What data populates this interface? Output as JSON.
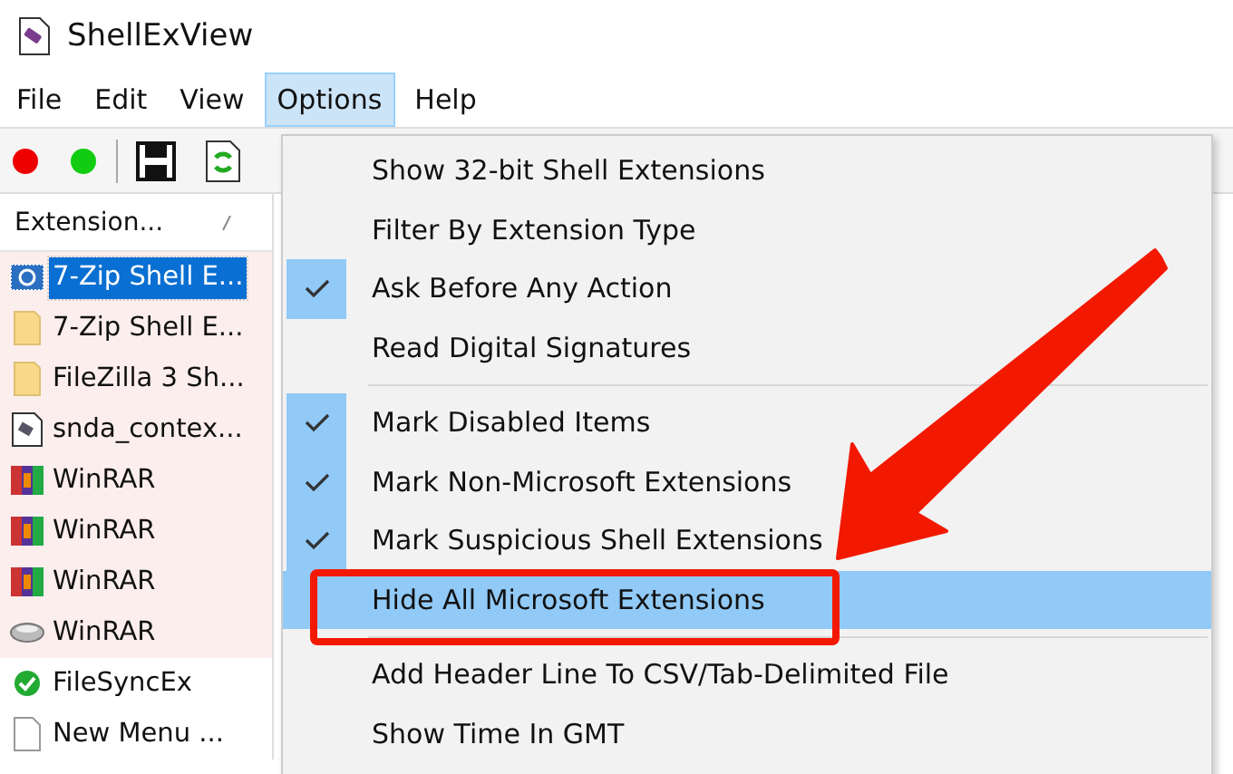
{
  "window": {
    "title": "ShellExView"
  },
  "menu_bar": [
    {
      "label": "File",
      "selected": false
    },
    {
      "label": "Edit",
      "selected": false
    },
    {
      "label": "View",
      "selected": false
    },
    {
      "label": "Options",
      "selected": true
    },
    {
      "label": "Help",
      "selected": false
    }
  ],
  "table": {
    "columns": [
      {
        "label": "Extension..."
      }
    ],
    "rows": [
      {
        "name": "7-Zip Shell E...",
        "kind": "component",
        "selected": true,
        "marked": true
      },
      {
        "name": "7-Zip Shell E...",
        "kind": "folder",
        "selected": false,
        "marked": true
      },
      {
        "name": "FileZilla 3 Sh...",
        "kind": "folder",
        "selected": false,
        "marked": true
      },
      {
        "name": "snda_contex...",
        "kind": "script",
        "selected": false,
        "marked": true
      },
      {
        "name": "WinRAR",
        "kind": "archive",
        "selected": false,
        "marked": true
      },
      {
        "name": "WinRAR",
        "kind": "archive",
        "selected": false,
        "marked": true
      },
      {
        "name": "WinRAR",
        "kind": "archive",
        "selected": false,
        "marked": true
      },
      {
        "name": "WinRAR",
        "kind": "drive",
        "selected": false,
        "marked": true
      },
      {
        "name": "FileSyncEx",
        "kind": "check",
        "selected": false,
        "marked": false
      },
      {
        "name": "New Menu ...",
        "kind": "page",
        "selected": false,
        "marked": false
      }
    ]
  },
  "options_menu": {
    "groups": [
      [
        {
          "label": "Show 32-bit Shell Extensions",
          "checked": false,
          "highlighted": false
        },
        {
          "label": "Filter By Extension Type",
          "checked": false,
          "highlighted": false
        },
        {
          "label": "Ask Before Any Action",
          "checked": true,
          "highlighted": false
        },
        {
          "label": "Read Digital Signatures",
          "checked": false,
          "highlighted": false
        }
      ],
      [
        {
          "label": "Mark Disabled Items",
          "checked": true,
          "highlighted": false
        },
        {
          "label": "Mark Non-Microsoft Extensions",
          "checked": true,
          "highlighted": false
        },
        {
          "label": "Mark Suspicious Shell Extensions",
          "checked": true,
          "highlighted": false
        },
        {
          "label": "Hide All Microsoft Extensions",
          "checked": false,
          "highlighted": true
        }
      ],
      [
        {
          "label": "Add Header Line To CSV/Tab-Delimited File",
          "checked": false,
          "highlighted": false
        },
        {
          "label": "Show Time In GMT",
          "checked": false,
          "highlighted": false
        }
      ]
    ]
  }
}
